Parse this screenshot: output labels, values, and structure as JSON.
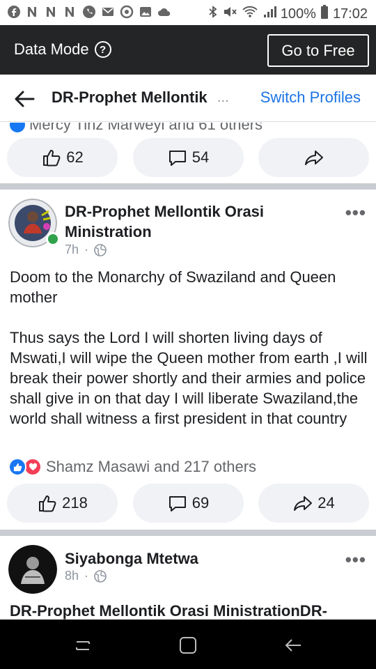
{
  "status_bar": {
    "battery": "100%",
    "time": "17:02"
  },
  "data_bar": {
    "label": "Data Mode",
    "help_icon": "?",
    "go_free_button": "Go to Free"
  },
  "header": {
    "title": "DR-Prophet Mellontik",
    "ellipsis": "...",
    "switch_profiles": "Switch Profiles"
  },
  "previous_post": {
    "partial_reactions_text": "Mercy Tinz Marweyi and 61 others",
    "actions": {
      "like_count": "62",
      "comment_count": "54"
    }
  },
  "post": {
    "author": "DR-Prophet Mellontik Orasi Ministration",
    "time": "7h",
    "dot": "·",
    "paragraphs": [
      "Doom to the Monarchy of Swaziland and Queen mother",
      "Thus says the Lord I will shorten living days of Mswati,I will wipe the Queen mother from earth ,I will break their power shortly and their armies and police shall give in on that day I will liberate Swaziland,the world shall witness a first president in that country"
    ],
    "reactions_text": "Shamz Masawi and 217 others",
    "actions": {
      "like_count": "218",
      "comment_count": "69",
      "share_count": "24"
    }
  },
  "next_post": {
    "author": "Siyabonga Mtetwa",
    "time": "8h",
    "dot": "·",
    "title_text": "DR-Prophet Mellontik Orasi MinistrationDR-"
  },
  "colors": {
    "accent_blue": "#1b74e4",
    "like_blue": "#1877f2",
    "love_red": "#f33e58",
    "online_green": "#31a24c",
    "dark_bar": "#242526"
  }
}
